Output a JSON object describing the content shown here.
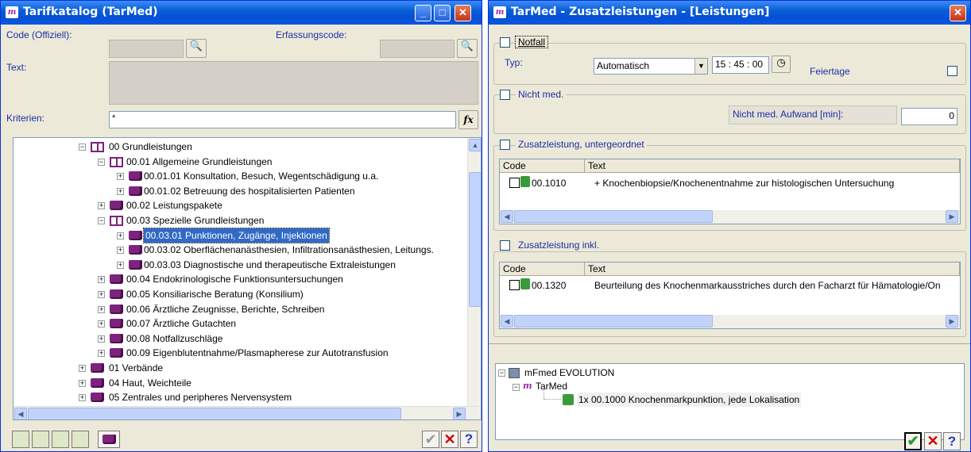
{
  "left": {
    "title": "Tarifkatalog (TarMed)",
    "code_label": "Code (Offiziell):",
    "erf_label": "Erfassungscode:",
    "text_label": "Text:",
    "krit_label": "Kriterien:",
    "krit_value": "*",
    "fx": "fx",
    "tree": [
      {
        "label": "00 Grundleistungen"
      },
      {
        "label": "00.01  Allgemeine Grundleistungen"
      },
      {
        "label": "00.01.01  Konsultation, Besuch, Wegentschädigung u.a."
      },
      {
        "label": "00.01.02  Betreuung des hospitalisierten Patienten"
      },
      {
        "label": "00.02  Leistungspakete"
      },
      {
        "label": "00.03  Spezielle Grundleistungen"
      },
      {
        "label": "00.03.01  Punktionen, Zugänge, Injektionen"
      },
      {
        "label": "00.03.02  Oberflächenanästhesien, Infiltrationsanästhesien, Leitungs."
      },
      {
        "label": "00.03.03  Diagnostische und therapeutische Extraleistungen"
      },
      {
        "label": "00.04  Endokrinologische Funktionsuntersuchungen"
      },
      {
        "label": "00.05  Konsiliarische Beratung (Konsilium)"
      },
      {
        "label": "00.06  Ärztliche Zeugnisse, Berichte, Schreiben"
      },
      {
        "label": "00.07  Ärztliche Gutachten"
      },
      {
        "label": "00.08  Notfallzuschläge"
      },
      {
        "label": "00.09  Eigenblutentnahme/Plasmapherese zur Autotransfusion"
      },
      {
        "label": "01 Verbände"
      },
      {
        "label": "04 Haut, Weichteile"
      },
      {
        "label": "05 Zentrales und peripheres Nervensystem"
      }
    ]
  },
  "right": {
    "title": "TarMed - Zusatzleistungen - [Leistungen]",
    "notfall": "Notfall",
    "typ_label": "Typ:",
    "typ_value": "Automatisch",
    "time": "15 : 45 : 00",
    "feiertage": "Feiertage",
    "nichtmed": "Nicht med.",
    "aufwand_label": "Nicht med. Aufwand [min]:",
    "aufwand_value": "0",
    "zus_unter": "Zusatzleistung, untergeordnet",
    "zus_inkl": "Zusatzleistung inkl.",
    "col_code": "Code",
    "col_text": "Text",
    "row1_code": "00.1010",
    "row1_text": "+ Knochenbiopsie/Knochenentnahme zur histologischen Untersuchung",
    "row2_code": "00.1320",
    "row2_text": "Beurteilung des Knochenmarkausstriches durch den Facharzt für Hämatologie/On",
    "tree_root": "mFmed EVOLUTION",
    "tree_tarmed": "TarMed",
    "tree_item": "1x  00.1000  Knochenmarkpunktion, jede Lokalisation"
  },
  "colors": {
    "title_bar": "#0a5fd8",
    "label_blue": "#1c2fa6",
    "book_purple": "#7c237c",
    "selection": "#316ac5"
  },
  "icons": [
    "search-icon",
    "fx-icon",
    "book-icon",
    "check-icon",
    "close-icon",
    "help-icon",
    "clock-icon"
  ]
}
